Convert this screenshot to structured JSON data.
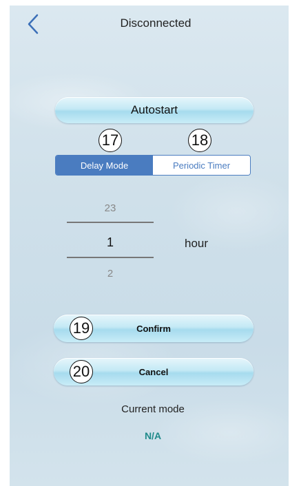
{
  "header": {
    "title": "Disconnected",
    "back_icon": "chevron-left-icon"
  },
  "autostart": {
    "label": "Autostart"
  },
  "markers": {
    "m17": "17",
    "m18": "18",
    "m19": "19",
    "m20": "20"
  },
  "mode_tabs": [
    {
      "label": "Delay Mode",
      "active": true
    },
    {
      "label": "Periodic Timer",
      "active": false
    }
  ],
  "picker": {
    "previous": "23",
    "selected": "1",
    "next": "2",
    "unit": "hour"
  },
  "actions": {
    "confirm_label": "Confirm",
    "cancel_label": "Cancel"
  },
  "status": {
    "current_mode_label": "Current mode",
    "current_mode_value": "N/A"
  },
  "colors": {
    "accent": "#4a7cc0",
    "status_value": "#1f8a8a"
  }
}
